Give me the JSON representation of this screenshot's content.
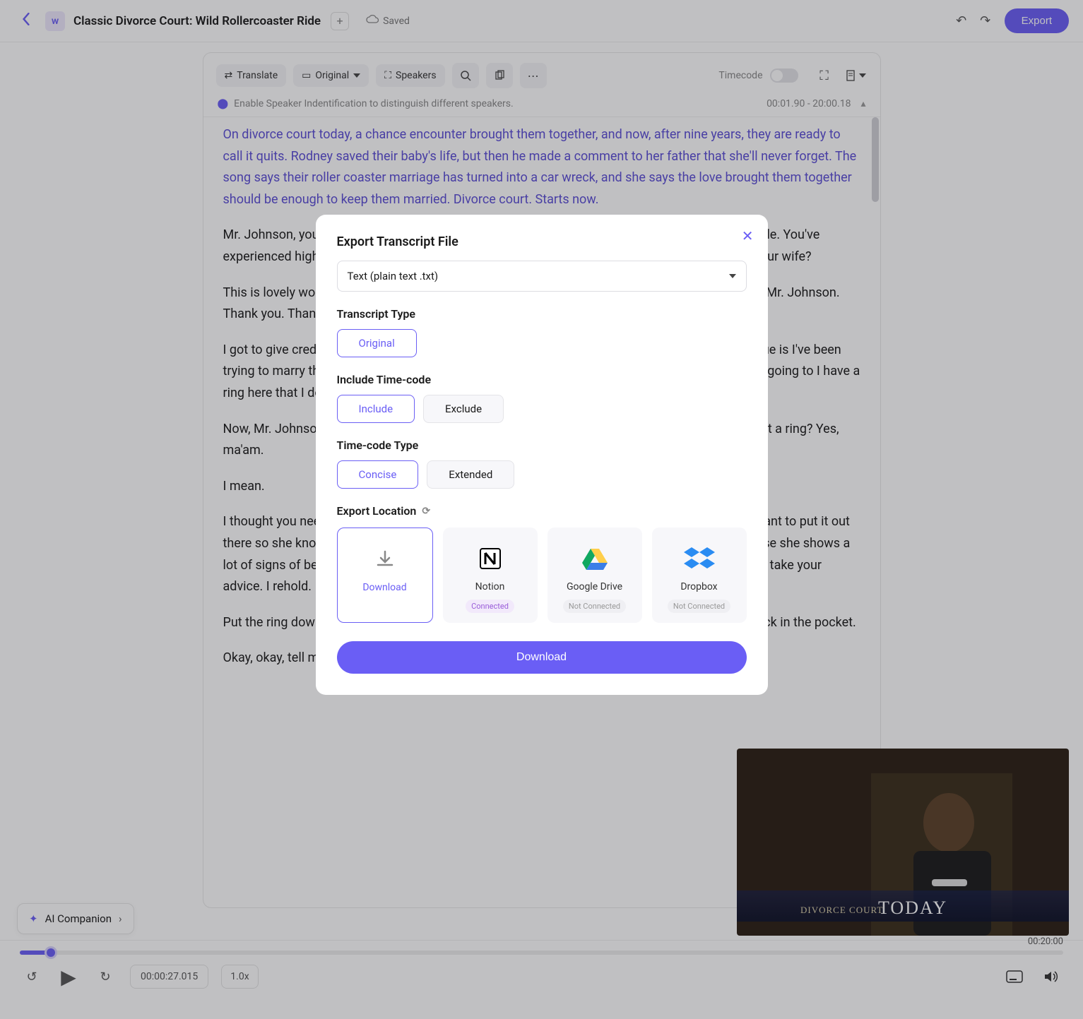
{
  "header": {
    "title": "Classic Divorce Court: Wild Rollercoaster Ride",
    "saved_label": "Saved",
    "export_label": "Export"
  },
  "toolbar": {
    "translate": "Translate",
    "original": "Original",
    "speakers": "Speakers",
    "timecode_label": "Timecode"
  },
  "notice": {
    "text": "Enable Speaker Indentification to distinguish different speakers.",
    "timestamp_range": "00:01.90 - 20:00.18"
  },
  "transcript": {
    "p1": "On divorce court today, a chance encounter brought them together, and now, after nine years, they are ready to call it quits. Rodney saved their baby's life, but then he made a comment to her father that she'll never forget. The song says their roller coaster marriage has turned into a car wreck, and she says the love brought them together should be enough to keep them married. Divorce court. Starts now.",
    "p2": "Mr. Johnson, you and Mrs. Johnson have been married for nine years. It's been a roller coaster ride. You've experienced highs, lows, and everything in between. Why don't you tell me about your ride with your wife?",
    "p3": "This is lovely woman right here. I just want to say it for the record. I met you none, but thank you, Mr. Johnson. Thank you. Thank you.",
    "p4": "I got to give credit where it's due generalities, yes, she's lovely. But just from the top, my main issue is I've been trying to marry this woman and she won't Forever. We have two beautiful children together. I was going to I have a ring here that I do plan on proposing today.",
    "p5": "Now, Mr. Johnson, you you realize you're in divorce court, right? You gonna roll in here and pull out a ring? Yes, ma'am.",
    "p6": "I mean.",
    "p7": "I thought you needed help because some of the issues that I'm reading is rough. I do, but I just want to put it out there so she knows that my heart is still in this engagement. She said she won't marry me because she shows a lot of signs of being immature. But before I get into the reasons, I was trying to maybe do that. I'll take your advice. I rehold.",
    "p8": "Put the ring down, Okay, okay, put it back in my pocket, put it back in my pocket, put it right on back in the pocket.",
    "p9": "Okay, okay, tell me about the ride. Okay, well, it starts off. About nine y..."
  },
  "ai_companion": {
    "label": "AI Companion"
  },
  "playback": {
    "duration": "00:20:00",
    "current_time": "00:00:27.015",
    "speed": "1.0x"
  },
  "video": {
    "title_line1": "DIVORCE COURT",
    "title_line2": "TODAY"
  },
  "modal": {
    "title": "Export Transcript File",
    "format_selected": "Text (plain text .txt)",
    "transcript_type_label": "Transcript Type",
    "transcript_type_original": "Original",
    "include_timecode_label": "Include Time-code",
    "include": "Include",
    "exclude": "Exclude",
    "timecode_type_label": "Time-code Type",
    "concise": "Concise",
    "extended": "Extended",
    "export_location_label": "Export Location",
    "locations": {
      "download": "Download",
      "notion": "Notion",
      "notion_status": "Connected",
      "gdrive": "Google Drive",
      "gdrive_status": "Not Connected",
      "dropbox": "Dropbox",
      "dropbox_status": "Not Connected"
    },
    "download_button": "Download"
  }
}
